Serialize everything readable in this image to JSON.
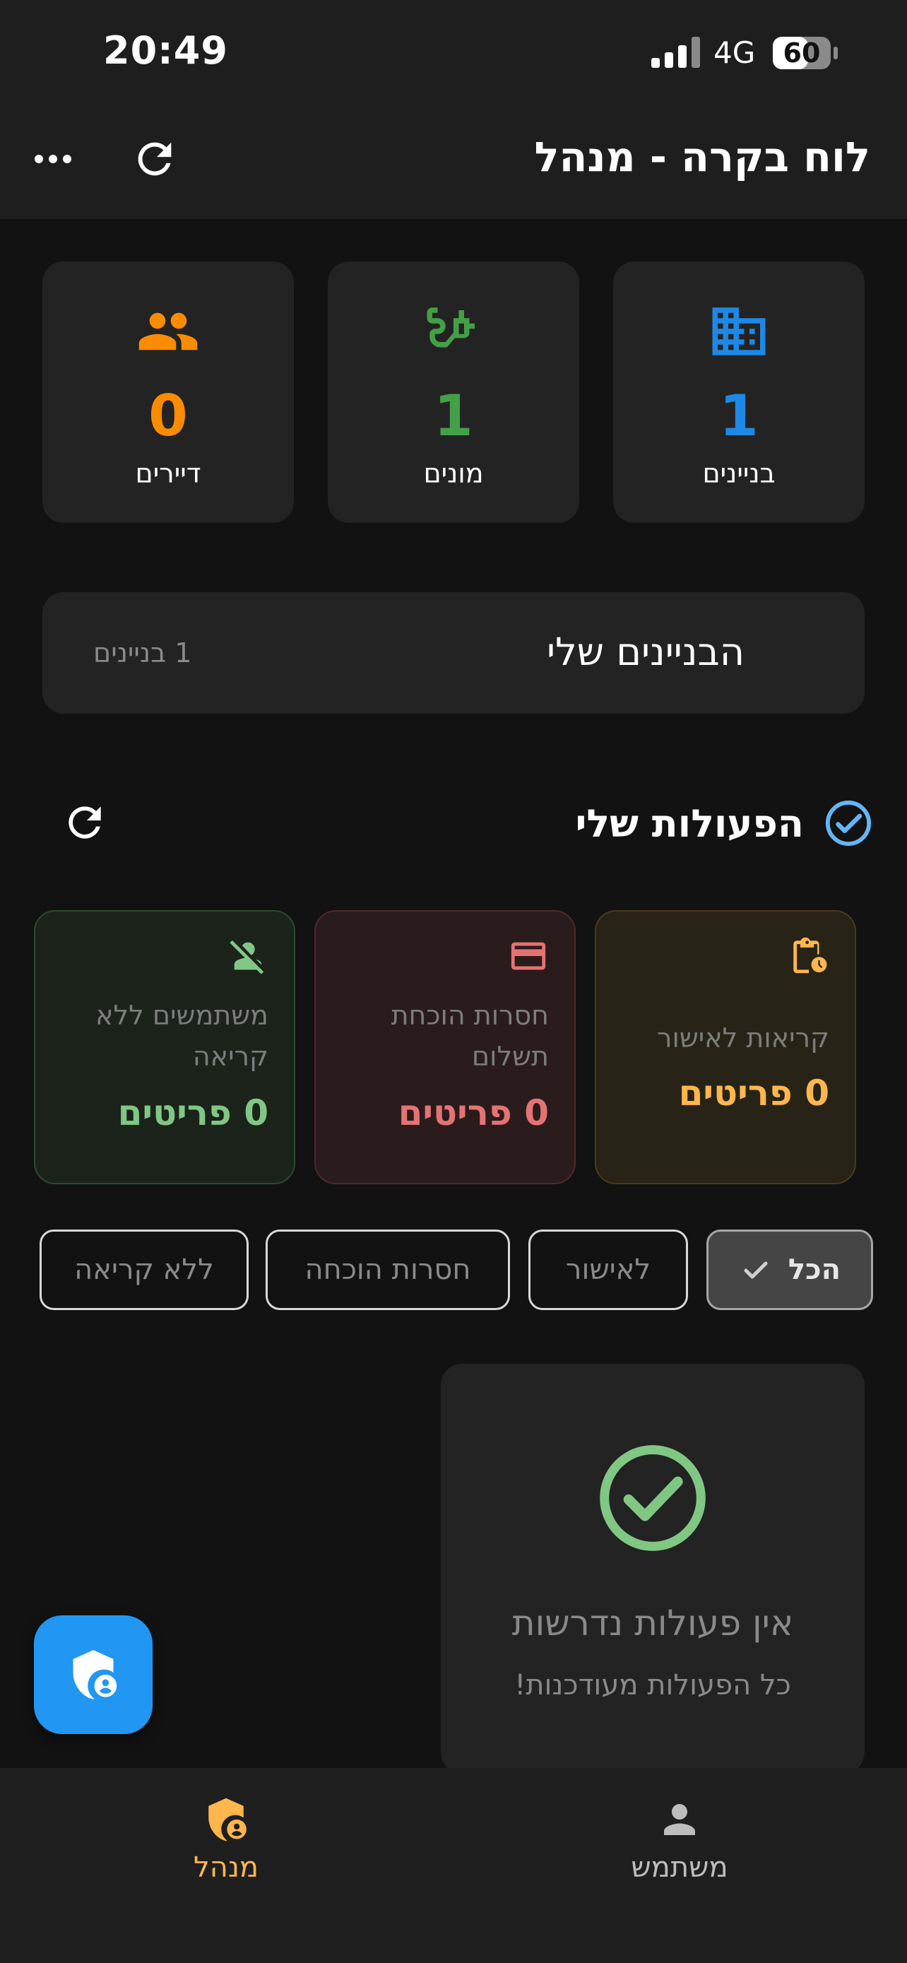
{
  "status_bar": {
    "time": "20:49",
    "network": "4G",
    "battery": "60"
  },
  "header": {
    "title": "לוח בקרה - מנהל"
  },
  "stats": [
    {
      "value": "1",
      "label": "בניינים",
      "icon": "building-icon",
      "color": "#1e88e5"
    },
    {
      "value": "1",
      "label": "מונים",
      "icon": "power-plug-icon",
      "color": "#43a047"
    },
    {
      "value": "0",
      "label": "דיירים",
      "icon": "people-icon",
      "color": "#fb8c00"
    }
  ],
  "my_buildings": {
    "title": "הבניינים שלי",
    "count": "1 בניינים"
  },
  "actions": {
    "title": "הפעולות שלי",
    "cards": [
      {
        "label": "קריאות לאישור",
        "count": "0 פריטים",
        "icon": "clipboard-clock-icon",
        "color": "#ffb74d"
      },
      {
        "label": "חסרות הוכחת תשלום",
        "count": "0 פריטים",
        "icon": "credit-card-icon",
        "color": "#e57373"
      },
      {
        "label": "משתמשים ללא קריאה",
        "count": "0 פריטים",
        "icon": "person-off-icon",
        "color": "#81c784"
      }
    ]
  },
  "filters": [
    {
      "label": "הכל",
      "selected": true
    },
    {
      "label": "לאישור",
      "selected": false
    },
    {
      "label": "חסרות הוכחה",
      "selected": false
    },
    {
      "label": "ללא קריאה",
      "selected": false
    }
  ],
  "empty_state": {
    "title": "אין פעולות נדרשות",
    "subtitle": "כל הפעולות מעודכנות!"
  },
  "bottom_nav": [
    {
      "label": "מנהל",
      "icon": "admin-shield-icon",
      "active": true,
      "color": "#ffb74d"
    },
    {
      "label": "משתמש",
      "icon": "person-icon",
      "active": false,
      "color": "#bdbdbd"
    }
  ]
}
